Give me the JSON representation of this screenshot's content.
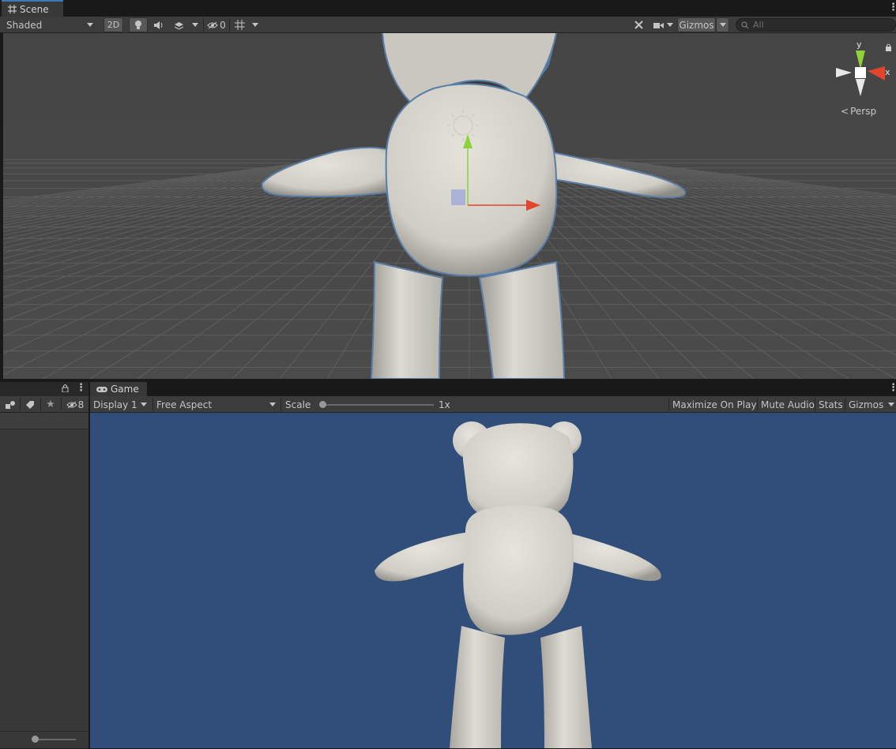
{
  "scene": {
    "tab_label": "Scene",
    "shading_mode": "Shaded",
    "mode_2d": "2D",
    "hidden_count": "0",
    "gizmos_label": "Gizmos",
    "search_placeholder": "All",
    "persp_label": "Persp",
    "axis_y": "y",
    "axis_x": "x",
    "grid_color": "#6f6f6f",
    "sky_color": "#464646"
  },
  "hierarchy": {
    "hidden_count": "8"
  },
  "game": {
    "tab_label": "Game",
    "display": "Display 1",
    "aspect": "Free Aspect",
    "scale_label": "Scale",
    "scale_value": "1x",
    "scale_fraction": 0.0,
    "maximize_on_play": "Maximize On Play",
    "mute_audio": "Mute Audio",
    "stats": "Stats",
    "gizmos": "Gizmos",
    "background_color": "#314d79"
  },
  "colors": {
    "accent_tab": "#3a79bb",
    "selection_outline": "#5a7ea8",
    "gizmo_y": "#8fd13a",
    "gizmo_x": "#e2452b",
    "model_color": "#dad8d0"
  }
}
